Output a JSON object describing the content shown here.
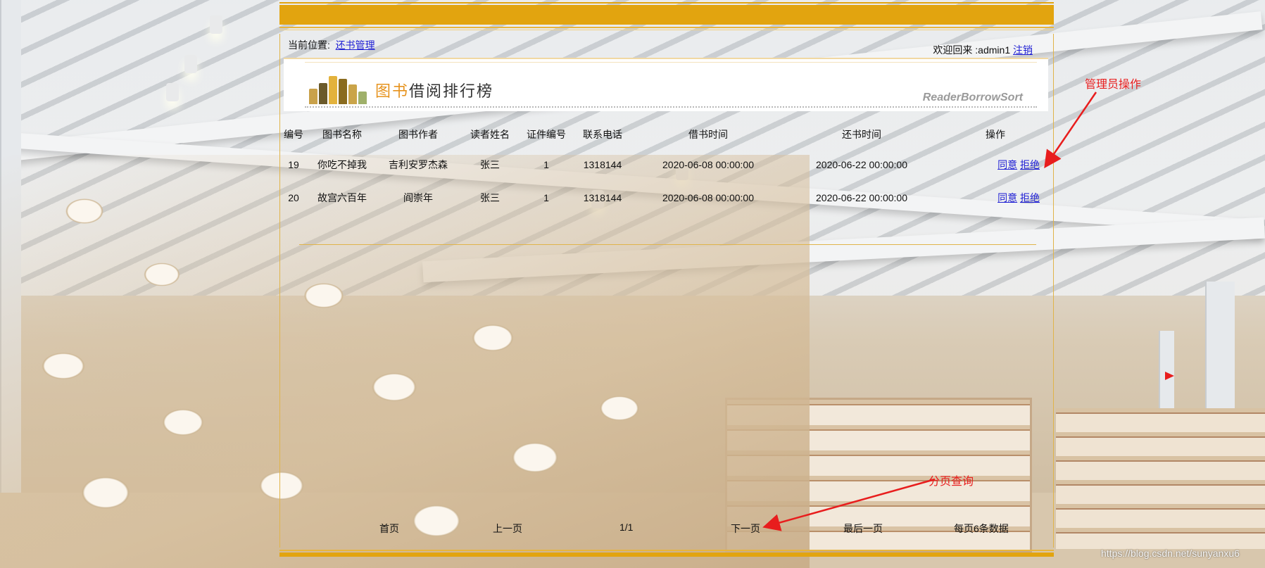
{
  "location": {
    "label": "当前位置:",
    "link": "还书管理"
  },
  "welcome": {
    "text": "欢迎回来 :admin1",
    "logout": "注销"
  },
  "banner": {
    "title_a": "图书",
    "title_b": "借阅排行榜",
    "subtitle": "ReaderBorrowSort"
  },
  "table": {
    "headers": [
      "编号",
      "图书名称",
      "图书作者",
      "读者姓名",
      "证件编号",
      "联系电话",
      "借书时间",
      "还书时间",
      "操作"
    ],
    "rows": [
      {
        "id": "19",
        "book": "你吃不掉我",
        "author": "吉利安罗杰森",
        "reader": "张三",
        "card": "1",
        "phone": "1318144",
        "borrow": "2020-06-08 00:00:00",
        "return": "2020-06-22 00:00:00",
        "agree": "同意",
        "reject": "拒绝"
      },
      {
        "id": "20",
        "book": "故宫六百年",
        "author": "阎崇年",
        "reader": "张三",
        "card": "1",
        "phone": "1318144",
        "borrow": "2020-06-08 00:00:00",
        "return": "2020-06-22 00:00:00",
        "agree": "同意",
        "reject": "拒绝"
      }
    ]
  },
  "pager": {
    "first": "首页",
    "prev": "上一页",
    "page": "1/1",
    "next": "下一页",
    "last": "最后一页",
    "per_page": "每页6条数据"
  },
  "annotations": {
    "admin_ops": "管理员操作",
    "paging": "分页查询"
  },
  "watermark": "https://blog.csdn.net/sunyanxu6",
  "colors": {
    "accent": "#e2a40f",
    "link": "#1f1fd4",
    "annotation": "#e81d1d"
  }
}
